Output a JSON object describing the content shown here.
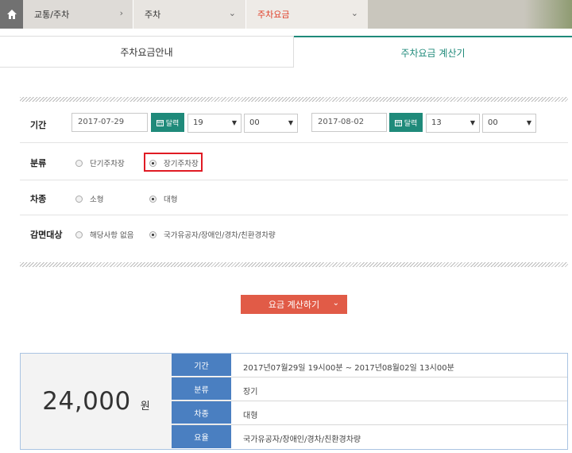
{
  "breadcrumb": {
    "items": [
      {
        "label": "교통/주차",
        "chevron": "›"
      },
      {
        "label": "주차",
        "chevron": "⌄"
      },
      {
        "label": "주차요금",
        "chevron": "⌄"
      }
    ]
  },
  "tabs": [
    {
      "label": "주차요금안내"
    },
    {
      "label": "주차요금 계산기"
    }
  ],
  "form": {
    "period": {
      "label": "기간",
      "start_date": "2017-07-29",
      "start_hour": "19",
      "start_min": "00",
      "end_date": "2017-08-02",
      "end_hour": "13",
      "end_min": "00",
      "calendar_label": "달력"
    },
    "category": {
      "label": "분류",
      "options": [
        "단기주차장",
        "장기주차장"
      ],
      "selected": "장기주차장"
    },
    "car_type": {
      "label": "차종",
      "options": [
        "소형",
        "대형"
      ],
      "selected": "대형"
    },
    "discount": {
      "label": "감면대상",
      "options": [
        "해당사항 없음",
        "국가유공자/장애인/경차/친환경차량"
      ],
      "selected": "국가유공자/장애인/경차/친환경차량"
    }
  },
  "calc_button": {
    "label": "요금 계산하기",
    "chevron": "⌄"
  },
  "result": {
    "amount": "24,000",
    "unit": "원",
    "rows": [
      {
        "key": "기간",
        "value": "2017년07월29일 19시00분 ~ 2017년08월02일 13시00분"
      },
      {
        "key": "분류",
        "value": "장기"
      },
      {
        "key": "차종",
        "value": "대형"
      },
      {
        "key": "요율",
        "value": "국가유공자/장애인/경차/친환경차량"
      }
    ]
  },
  "colors": {
    "accent": "#1f8a7a",
    "active_crumb": "#e0402a",
    "button": "#e15b47",
    "table_key": "#4a7fc1",
    "highlight": "#e01b24"
  }
}
